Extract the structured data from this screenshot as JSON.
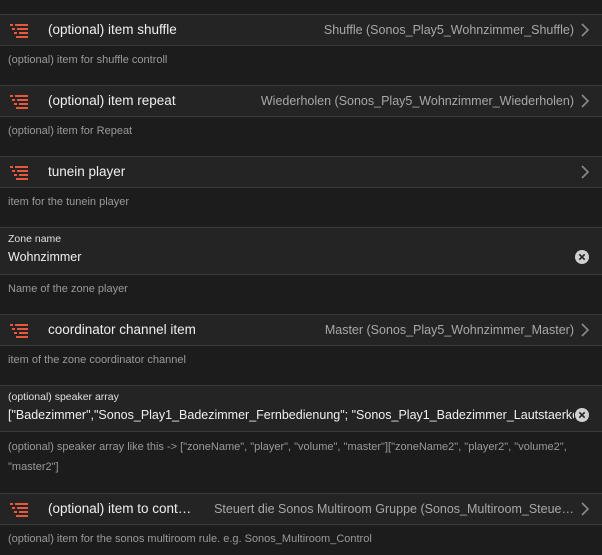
{
  "items": [
    {
      "title": "(optional) item shuffle",
      "value": "Shuffle (Sonos_Play5_Wohnzimmer_Shuffle)",
      "description": "(optional) item for shuffle controll"
    },
    {
      "title": "(optional) item repeat",
      "value": "Wiederholen (Sonos_Play5_Wohnzimmer_Wiederholen)",
      "description": "(optional) item for Repeat"
    },
    {
      "title": "tunein player",
      "value": "",
      "description": "item for the tunein player"
    },
    {
      "title": "coordinator channel item",
      "value": "Master (Sonos_Play5_Wohnzimmer_Master)",
      "description": "item of the zone coordinator channel"
    },
    {
      "title": "(optional) item to cont…",
      "value": "Steuert die Sonos Multiroom Gruppe (Sonos_Multiroom_Steue…",
      "description": "(optional) item for the sonos multiroom rule. e.g. Sonos_Multiroom_Control"
    }
  ],
  "zone_name": {
    "label": "Zone name",
    "value": "Wohnzimmer",
    "description": "Name of the zone player"
  },
  "speaker_array": {
    "label": "(optional) speaker array",
    "value": "[\"Badezimmer\",\"Sonos_Play1_Badezimmer_Fernbedienung\"; \"Sonos_Play1_Badezimmer_Lautstaerke",
    "description_line1": "(optional) speaker array like this -> [\"zoneName\", \"player\", \"volume\", \"master\"][\"zoneName2\", \"player2\", \"volume2\",",
    "description_line2": "\"master2\"]"
  },
  "colors": {
    "item_icon": "#e8593c",
    "background": "#1c1c1c",
    "row_background": "#242424"
  },
  "icons": {
    "item": "list-icon",
    "chevron": "chevron-right-icon",
    "clear": "clear-icon"
  }
}
